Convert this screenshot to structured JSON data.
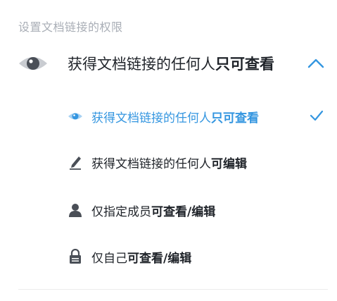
{
  "section_title": "设置文档链接的权限",
  "dropdown": {
    "label_prefix": "获得文档链接的任何人",
    "label_bold": "只可查看"
  },
  "options": [
    {
      "prefix": "获得文档链接的任何人",
      "bold": "只可查看",
      "icon": "eye-icon",
      "selected": true
    },
    {
      "prefix": "获得文档链接的任何人",
      "bold": "可编辑",
      "icon": "pencil-icon",
      "selected": false
    },
    {
      "prefix": "仅指定成员",
      "bold": "可查看/编辑",
      "icon": "person-icon",
      "selected": false
    },
    {
      "prefix": "仅自己",
      "bold": "可查看/编辑",
      "icon": "lock-icon",
      "selected": false
    }
  ],
  "colors": {
    "accent": "#3496e0",
    "text": "#1f2329",
    "muted": "#a9aeb6",
    "icon": "#4a4f57"
  }
}
